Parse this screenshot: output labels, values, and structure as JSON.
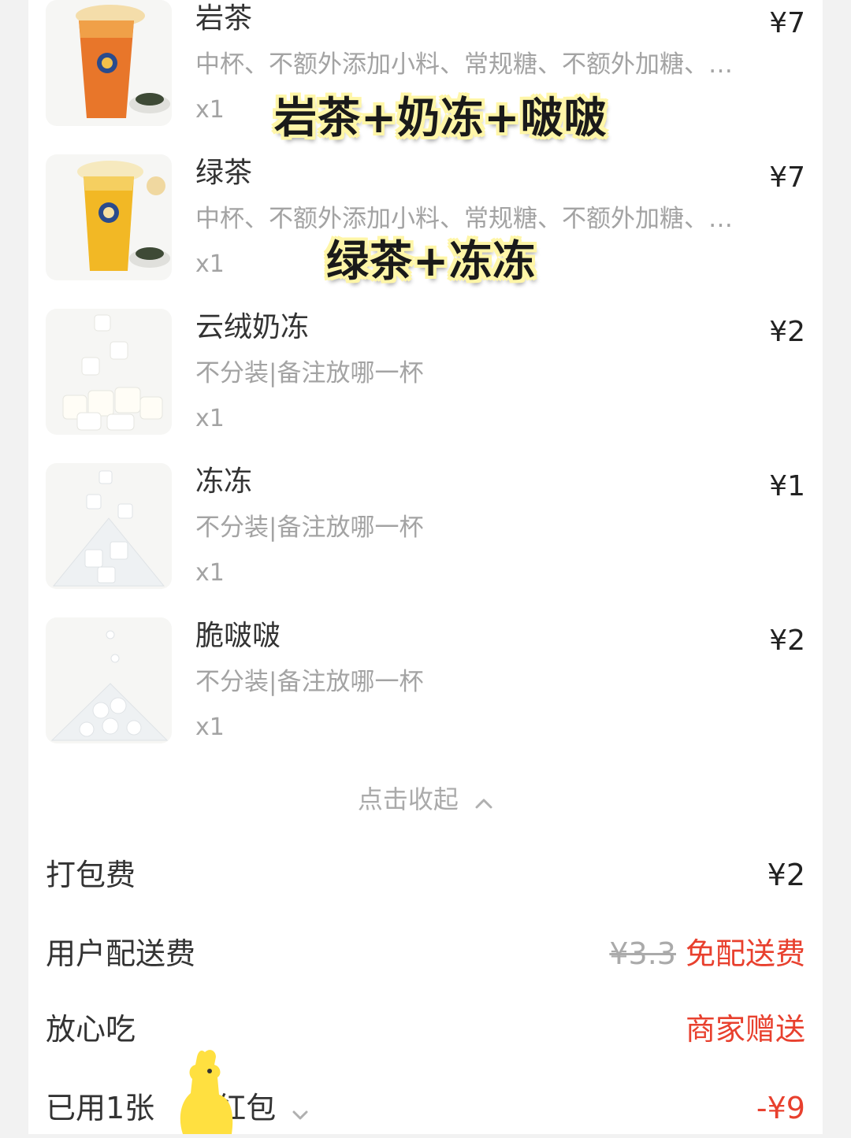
{
  "items": [
    {
      "name": "岩茶",
      "price": "¥7",
      "spec": "中杯、不额外添加小料、常规糖、不额外加糖、…",
      "qty": "x1"
    },
    {
      "name": "绿茶",
      "price": "¥7",
      "spec": "中杯、不额外添加小料、常规糖、不额外加糖、…",
      "qty": "x1"
    },
    {
      "name": "云绒奶冻",
      "price": "¥2",
      "spec": "不分装|备注放哪一杯",
      "qty": "x1"
    },
    {
      "name": "冻冻",
      "price": "¥1",
      "spec": "不分装|备注放哪一杯",
      "qty": "x1"
    },
    {
      "name": "脆啵啵",
      "price": "¥2",
      "spec": "不分装|备注放哪一杯",
      "qty": "x1"
    }
  ],
  "overlays": {
    "first": "岩茶+奶冻+啵啵",
    "second": "绿茶+冻冻"
  },
  "collapse_label": "点击收起",
  "fees": {
    "packing_label": "打包费",
    "packing_value": "¥2",
    "delivery_label": "用户配送费",
    "delivery_original": "¥3.3",
    "delivery_value": "免配送费",
    "assurance_label": "放心吃",
    "assurance_value": "商家赠送",
    "coupon_label_a": "已用1张",
    "coupon_label_b": "红包",
    "coupon_value": "-¥9"
  },
  "colors": {
    "accent_red": "#e8402e",
    "tea_orange": "#e8762a",
    "tea_yellow": "#f2b825",
    "mascot_yellow": "#ffe040"
  },
  "icons": [
    "chevron-up-icon",
    "chevron-down-icon",
    "kangaroo-mascot-icon"
  ]
}
